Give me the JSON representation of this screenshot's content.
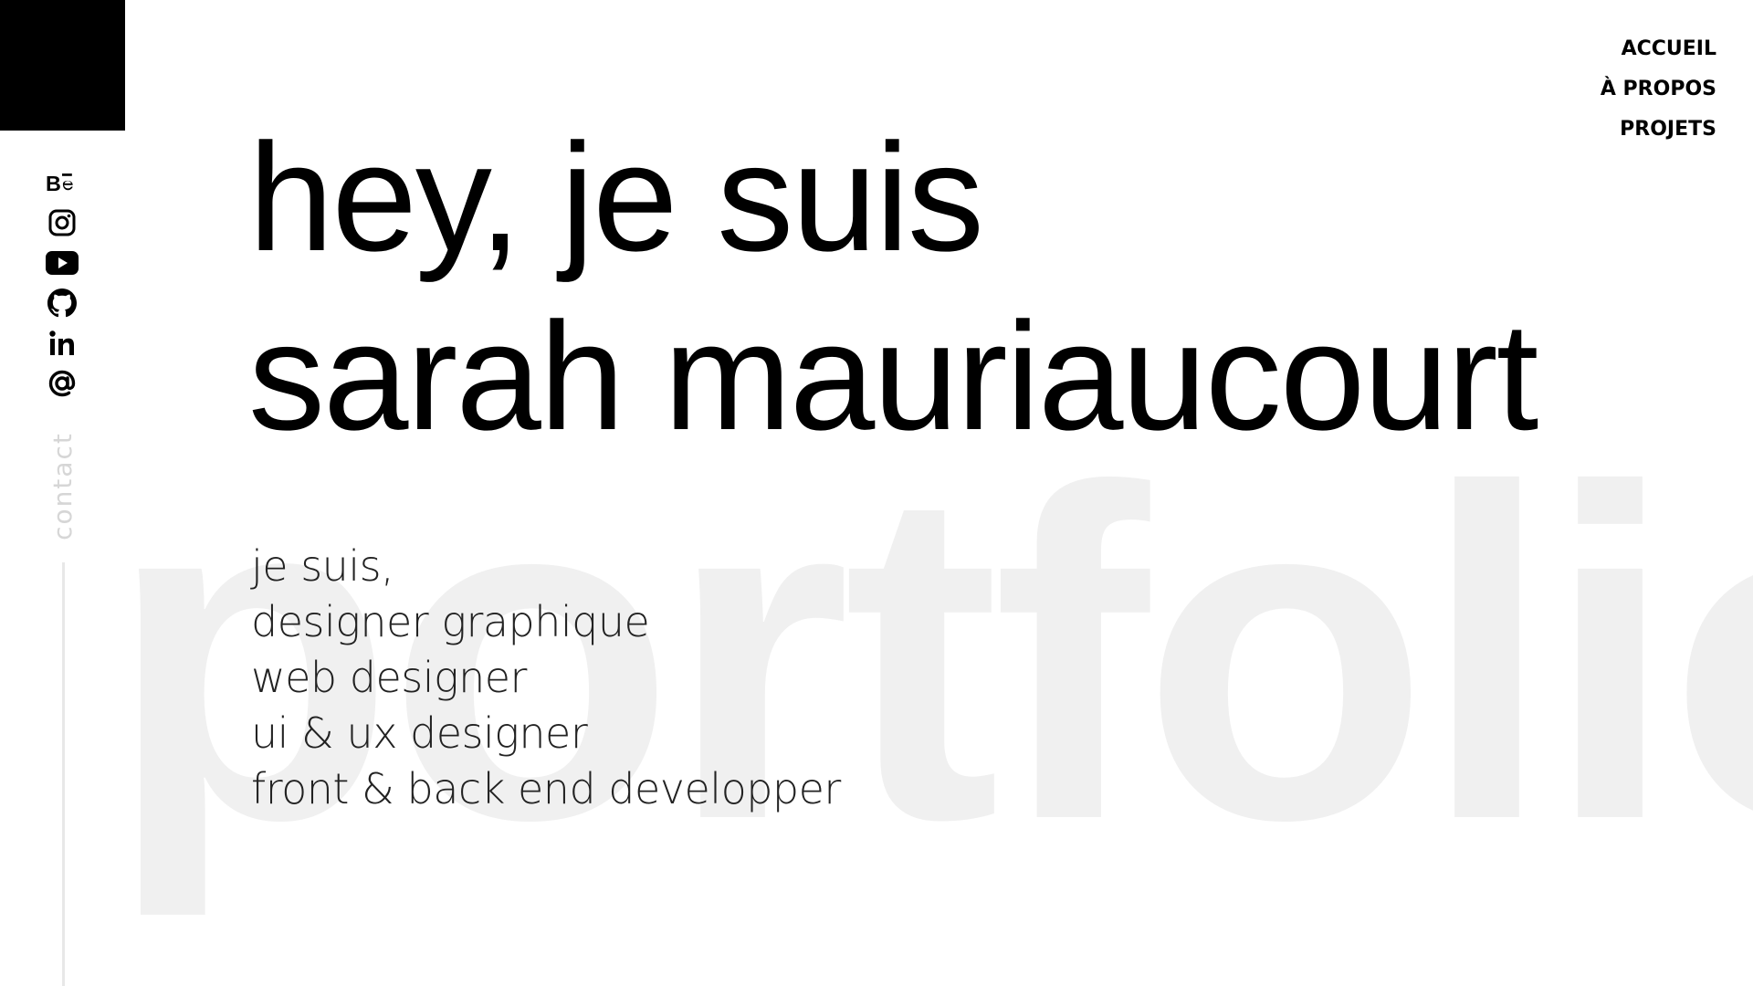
{
  "watermark": {
    "text": "portfolio"
  },
  "nav": {
    "items": [
      {
        "label": "ACCUEIL"
      },
      {
        "label": "À PROPOS"
      },
      {
        "label": "PROJETS"
      }
    ]
  },
  "social": {
    "items": [
      {
        "name": "behance",
        "icon": "behance-icon"
      },
      {
        "name": "instagram",
        "icon": "instagram-icon"
      },
      {
        "name": "youtube",
        "icon": "youtube-icon"
      },
      {
        "name": "github",
        "icon": "github-icon"
      },
      {
        "name": "linkedin",
        "icon": "linkedin-icon"
      },
      {
        "name": "email",
        "icon": "at-sign-icon"
      }
    ],
    "contact_label": "contact"
  },
  "hero": {
    "line1": "hey, je suis",
    "line2": "sarah mauriaucourt"
  },
  "roles": {
    "items": [
      "je suis,",
      "designer graphique",
      "web designer",
      "ui & ux designer",
      "front & back end developper"
    ]
  },
  "colors": {
    "background": "#ffffff",
    "text": "#000000",
    "watermark": "#f0f0f0",
    "contact_label": "#d6d6d6"
  }
}
